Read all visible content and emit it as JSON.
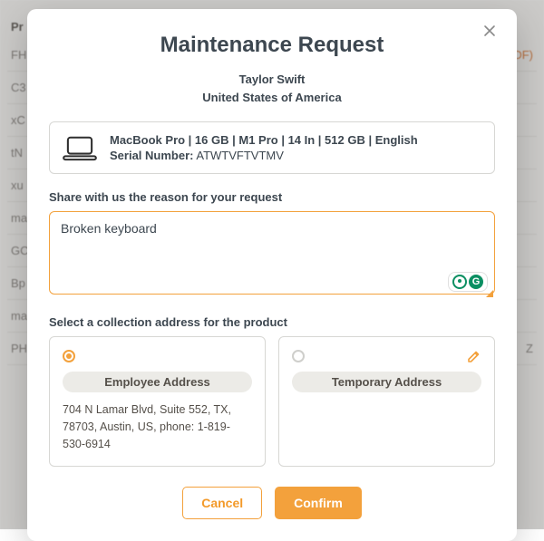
{
  "background": {
    "header": "Pr",
    "rows_left": [
      "FH",
      "C3",
      "xC",
      "tN",
      "xu",
      "ma",
      "GC",
      "Bp",
      "ma",
      "PH"
    ],
    "rows_right": [
      "DF)",
      "",
      "",
      "",
      "",
      "",
      "",
      "",
      "",
      "Z"
    ]
  },
  "modal": {
    "title": "Maintenance Request",
    "user": "Taylor Swift",
    "country": "United States of America",
    "product": {
      "title": "MacBook Pro | 16 GB | M1 Pro | 14 In | 512 GB | English",
      "serial_label": "Serial Number:",
      "serial": "ATWTVFTVTMV"
    },
    "reason_label": "Share with us the reason for your request",
    "reason_value": "Broken keyboard",
    "address_label": "Select a collection address for the product",
    "addresses": [
      {
        "name": "Employee Address",
        "selected": true,
        "text": "704 N Lamar Blvd, Suite 552, TX, 78703, Austin, US, phone: 1-819-530-6914"
      },
      {
        "name": "Temporary Address",
        "selected": false,
        "text": ""
      }
    ],
    "buttons": {
      "cancel": "Cancel",
      "confirm": "Confirm"
    }
  }
}
